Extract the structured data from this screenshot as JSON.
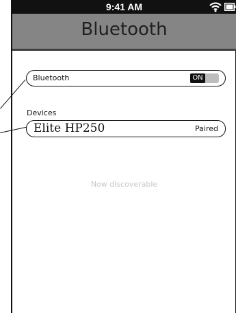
{
  "status_bar": {
    "time": "9:41 AM",
    "wifi_icon": "wifi-icon",
    "battery_icon": "battery-icon"
  },
  "header": {
    "title": "Bluetooth"
  },
  "bluetooth_toggle": {
    "label": "Bluetooth",
    "state": "ON"
  },
  "devices": {
    "section_label": "Devices",
    "items": [
      {
        "name": "Elite HP250",
        "status": "Paired"
      }
    ]
  },
  "discovery": {
    "message": "Now discoverable"
  },
  "colors": {
    "status_bar": "#111111",
    "title_bar": "#858585",
    "toggle_on": "#111111",
    "toggle_track": "#bdbdbd",
    "muted_text": "#c8c8c8"
  }
}
